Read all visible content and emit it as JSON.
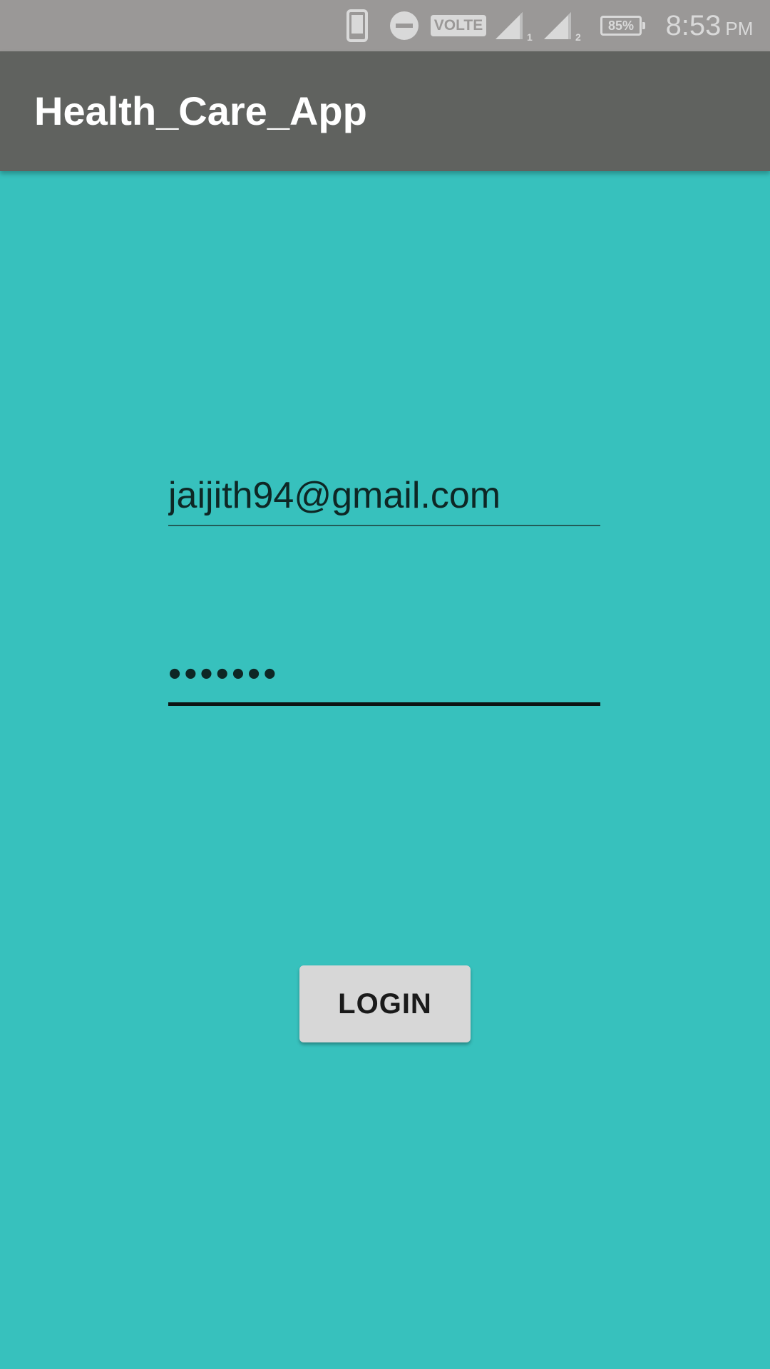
{
  "status_bar": {
    "icons": [
      "phone-icon",
      "do-not-disturb-icon",
      "volte-badge",
      "signal-sim1-icon",
      "signal-sim2-icon",
      "battery-icon"
    ],
    "volte_label": "VOLTE",
    "sim1_label": "1",
    "sim2_label": "2",
    "battery_percent": "85%",
    "time": "8:53",
    "ampm": "PM",
    "text_color": "#d9d9d9",
    "background": "#9a9897"
  },
  "app_bar": {
    "title": "Health_Care_App",
    "background": "#60625f"
  },
  "login_form": {
    "email_value": "jaijith94@gmail.com",
    "password_value": "•••••••",
    "login_label": "LOGIN"
  },
  "colors": {
    "screen_background": "#37c1bd",
    "button_background": "#d7d7d7",
    "input_text": "#0e2725"
  }
}
